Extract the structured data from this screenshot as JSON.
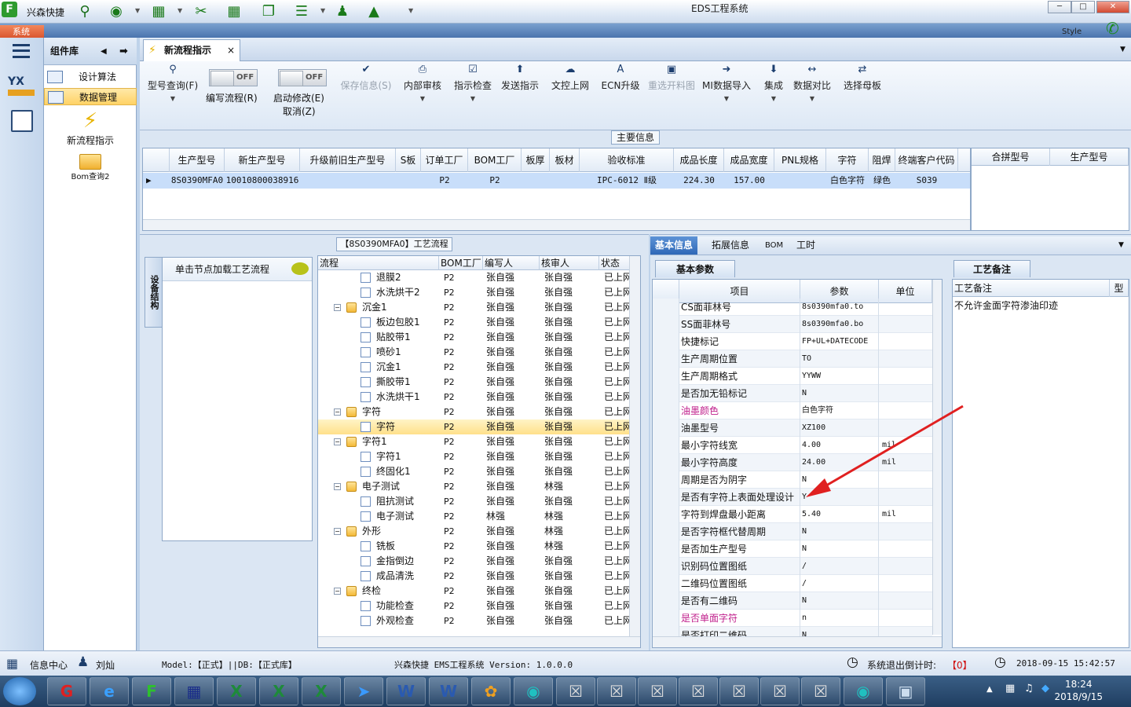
{
  "app": {
    "title": "EDS工程系统",
    "quick_label": "兴森快捷",
    "system_tab": "系统",
    "style_label": "Style"
  },
  "window": {
    "min": "─",
    "max": "□",
    "close": "✕"
  },
  "components": {
    "title": "组件库",
    "items": [
      {
        "label": "设计算法"
      },
      {
        "label": "数据管理"
      }
    ],
    "big": [
      {
        "label": "新流程指示"
      },
      {
        "label": "Bom查询2"
      }
    ]
  },
  "doc_tab": {
    "label": "新流程指示",
    "close": "×"
  },
  "ribbon": {
    "search": {
      "label": "型号查询(F)"
    },
    "write_flow": {
      "label": "编写流程(R)",
      "toggle": "OFF"
    },
    "start_edit": {
      "label": "启动修改(E)",
      "label2": "取消(Z)",
      "toggle": "OFF"
    },
    "buttons": [
      {
        "label": "保存信息(S)",
        "disabled": true,
        "dd": false
      },
      {
        "label": "内部审核",
        "disabled": false,
        "dd": true
      },
      {
        "label": "指示检查",
        "disabled": false,
        "dd": true
      },
      {
        "label": "发送指示",
        "disabled": false,
        "dd": false
      },
      {
        "label": "文控上网",
        "disabled": false,
        "dd": false
      },
      {
        "label": "ECN升级",
        "disabled": false,
        "dd": false
      },
      {
        "label": "重选开料图",
        "disabled": true,
        "dd": false
      },
      {
        "label": "MI数据导入",
        "disabled": false,
        "dd": true
      },
      {
        "label": "集成",
        "disabled": false,
        "dd": true
      },
      {
        "label": "数据对比",
        "disabled": false,
        "dd": true
      },
      {
        "label": "选择母板",
        "disabled": false,
        "dd": false
      }
    ]
  },
  "main_info": {
    "title": "主要信息",
    "headers": [
      "生产型号",
      "新生产型号",
      "升级前旧生产型号",
      "S板",
      "订单工厂",
      "BOM工厂",
      "板厚",
      "板材",
      "验收标准",
      "成品长度",
      "成品宽度",
      "PNL规格",
      "字符",
      "阻焊",
      "终端客户代码"
    ],
    "row": [
      "8S0390MFA0",
      "10010800038916",
      "",
      "",
      "P2",
      "P2",
      "",
      "",
      "IPC-6012 Ⅱ级",
      "224.30",
      "157.00",
      "",
      "白色字符",
      "绿色",
      "S039"
    ],
    "side_headers": [
      "合拼型号",
      "生产型号"
    ]
  },
  "workflow": {
    "title": "【8S0390MFA0】工艺流程",
    "vtab": "设备结构",
    "left_hint": "单击节点加载工艺流程",
    "headers": [
      "流程",
      "BOM工厂",
      "编写人",
      "核审人",
      "状态"
    ],
    "rows": [
      {
        "name": "退膜2",
        "level": 1,
        "bom": "P2",
        "writer": "张自强",
        "reviewer": "张自强",
        "status": "已上网"
      },
      {
        "name": "水洗烘干2",
        "level": 1,
        "bom": "P2",
        "writer": "张自强",
        "reviewer": "张自强",
        "status": "已上网"
      },
      {
        "name": "沉金1",
        "level": 0,
        "bom": "P2",
        "writer": "张自强",
        "reviewer": "张自强",
        "status": "已上网"
      },
      {
        "name": "板边包胶1",
        "level": 1,
        "bom": "P2",
        "writer": "张自强",
        "reviewer": "张自强",
        "status": "已上网"
      },
      {
        "name": "贴胶带1",
        "level": 1,
        "bom": "P2",
        "writer": "张自强",
        "reviewer": "张自强",
        "status": "已上网"
      },
      {
        "name": "喷砂1",
        "level": 1,
        "bom": "P2",
        "writer": "张自强",
        "reviewer": "张自强",
        "status": "已上网"
      },
      {
        "name": "沉金1",
        "level": 1,
        "bom": "P2",
        "writer": "张自强",
        "reviewer": "张自强",
        "status": "已上网"
      },
      {
        "name": "撕胶带1",
        "level": 1,
        "bom": "P2",
        "writer": "张自强",
        "reviewer": "张自强",
        "status": "已上网"
      },
      {
        "name": "水洗烘干1",
        "level": 1,
        "bom": "P2",
        "writer": "张自强",
        "reviewer": "张自强",
        "status": "已上网"
      },
      {
        "name": "字符",
        "level": 0,
        "bom": "P2",
        "writer": "张自强",
        "reviewer": "张自强",
        "status": "已上网"
      },
      {
        "name": "字符",
        "level": 1,
        "bom": "P2",
        "writer": "张自强",
        "reviewer": "张自强",
        "status": "已上网",
        "selected": true
      },
      {
        "name": "字符1",
        "level": 0,
        "bom": "P2",
        "writer": "张自强",
        "reviewer": "张自强",
        "status": "已上网"
      },
      {
        "name": "字符1",
        "level": 1,
        "bom": "P2",
        "writer": "张自强",
        "reviewer": "张自强",
        "status": "已上网"
      },
      {
        "name": "终固化1",
        "level": 1,
        "bom": "P2",
        "writer": "张自强",
        "reviewer": "张自强",
        "status": "已上网"
      },
      {
        "name": "电子测试",
        "level": 0,
        "bom": "P2",
        "writer": "张自强",
        "reviewer": "林强",
        "status": "已上网"
      },
      {
        "name": "阻抗测试",
        "level": 1,
        "bom": "P2",
        "writer": "张自强",
        "reviewer": "张自强",
        "status": "已上网"
      },
      {
        "name": "电子测试",
        "level": 1,
        "bom": "P2",
        "writer": "林强",
        "reviewer": "林强",
        "status": "已上网"
      },
      {
        "name": "外形",
        "level": 0,
        "bom": "P2",
        "writer": "张自强",
        "reviewer": "林强",
        "status": "已上网"
      },
      {
        "name": "铣板",
        "level": 1,
        "bom": "P2",
        "writer": "张自强",
        "reviewer": "林强",
        "status": "已上网"
      },
      {
        "name": "金指倒边",
        "level": 1,
        "bom": "P2",
        "writer": "张自强",
        "reviewer": "张自强",
        "status": "已上网"
      },
      {
        "name": "成品清洗",
        "level": 1,
        "bom": "P2",
        "writer": "张自强",
        "reviewer": "张自强",
        "status": "已上网"
      },
      {
        "name": "终检",
        "level": 0,
        "bom": "P2",
        "writer": "张自强",
        "reviewer": "张自强",
        "status": "已上网"
      },
      {
        "name": "功能检查",
        "level": 1,
        "bom": "P2",
        "writer": "张自强",
        "reviewer": "张自强",
        "status": "已上网"
      },
      {
        "name": "外观检查",
        "level": 1,
        "bom": "P2",
        "writer": "张自强",
        "reviewer": "张自强",
        "status": "已上网"
      }
    ]
  },
  "right": {
    "tabs": [
      "基本信息",
      "拓展信息",
      "BOM",
      "工时"
    ],
    "param_tab": "基本参数",
    "headers": [
      "项目",
      "参数",
      "单位"
    ],
    "params": [
      {
        "item": "CS面菲林号",
        "value": "8s0390mfa0.to",
        "unit": "",
        "color": ""
      },
      {
        "item": "SS面菲林号",
        "value": "8s0390mfa0.bo",
        "unit": "",
        "color": ""
      },
      {
        "item": "快捷标记",
        "value": "FP+UL+DATECODE",
        "unit": "",
        "color": ""
      },
      {
        "item": "生产周期位置",
        "value": "TO",
        "unit": "",
        "color": ""
      },
      {
        "item": "生产周期格式",
        "value": "YYWW",
        "unit": "",
        "color": ""
      },
      {
        "item": "是否加无铅标记",
        "value": "N",
        "unit": "",
        "color": ""
      },
      {
        "item": "油墨颜色",
        "value": "白色字符",
        "unit": "",
        "color": "#c0208c"
      },
      {
        "item": "油墨型号",
        "value": "XZ100",
        "unit": "",
        "color": ""
      },
      {
        "item": "最小字符线宽",
        "value": "4.00",
        "unit": "mil",
        "color": ""
      },
      {
        "item": "最小字符高度",
        "value": "24.00",
        "unit": "mil",
        "color": ""
      },
      {
        "item": "周期是否为阴字",
        "value": "N",
        "unit": "",
        "color": ""
      },
      {
        "item": "是否有字符上表面处理设计",
        "value": "Y",
        "unit": "",
        "color": ""
      },
      {
        "item": "字符到焊盘最小距离",
        "value": "5.40",
        "unit": "mil",
        "color": ""
      },
      {
        "item": "是否字符框代替周期",
        "value": "N",
        "unit": "",
        "color": ""
      },
      {
        "item": "是否加生产型号",
        "value": "N",
        "unit": "",
        "color": ""
      },
      {
        "item": "识别码位置图纸",
        "value": "/",
        "unit": "",
        "color": ""
      },
      {
        "item": "二维码位置图纸",
        "value": "/",
        "unit": "",
        "color": ""
      },
      {
        "item": "是否有二维码",
        "value": "N",
        "unit": "",
        "color": ""
      },
      {
        "item": "是否单面字符",
        "value": "n",
        "unit": "",
        "color": "#c0208c"
      },
      {
        "item": "是否打印二维码",
        "value": "N",
        "unit": "",
        "color": ""
      }
    ],
    "note_tab": "工艺备注",
    "note_headers": [
      "工艺备注",
      "型"
    ],
    "note_text": "不允许金面字符渗油印迹"
  },
  "status": {
    "info_center": "信息中心",
    "user": "刘灿",
    "model": "Model:【正式】||DB:【正式库】",
    "version": "兴森快捷 EMS工程系统 Version: 1.0.0.0",
    "countdown_label": "系统退出倒计时:",
    "countdown": "【0】",
    "datetime": "2018-09-15 15:42:57"
  },
  "taskbar": {
    "time": "18:24",
    "date": "2018/9/15"
  }
}
